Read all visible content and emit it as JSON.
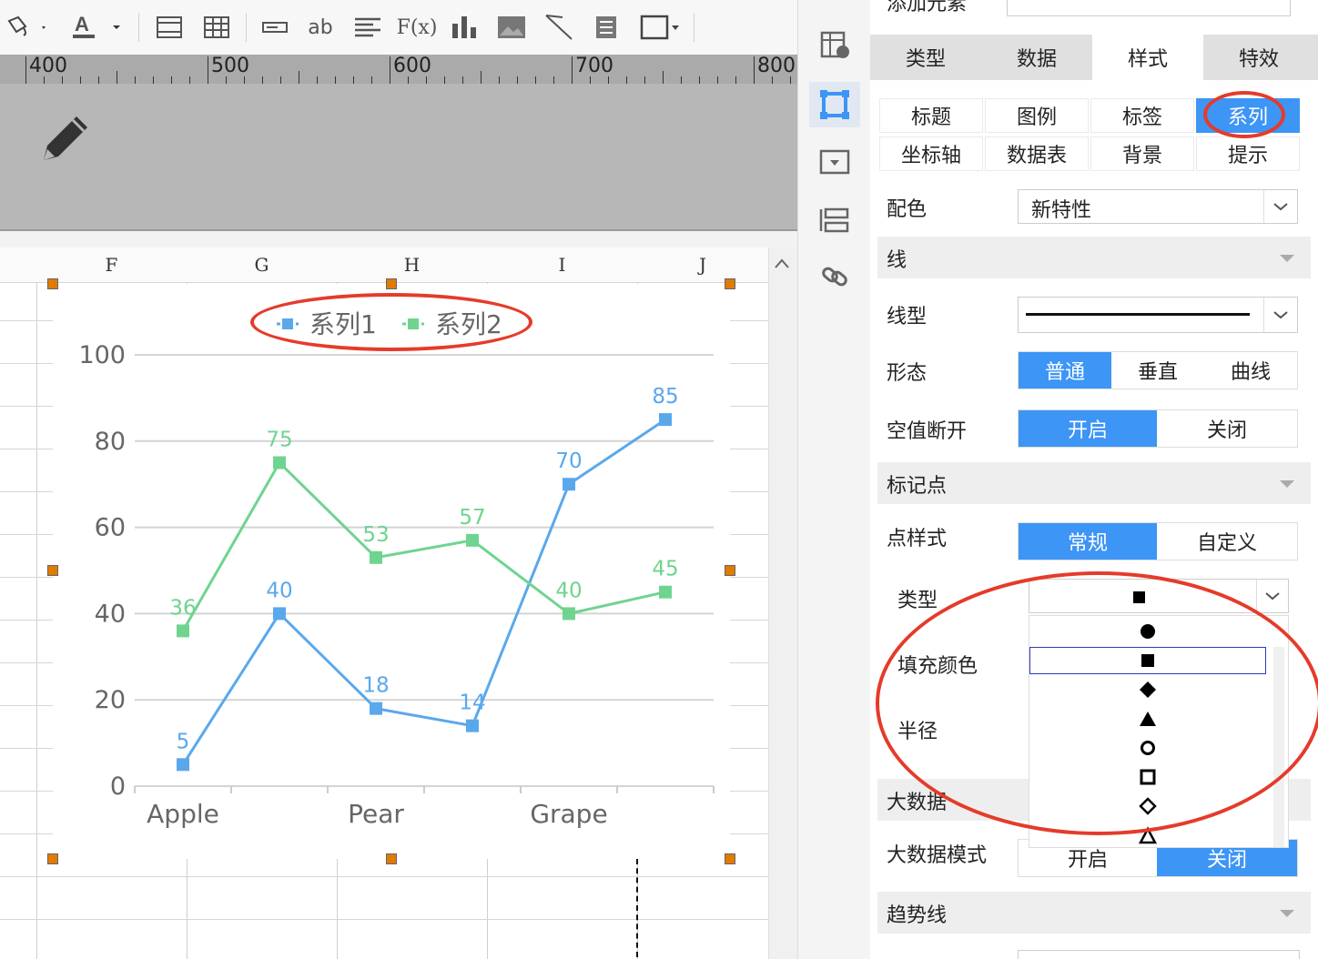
{
  "toolbar": {
    "text_button_label": "ab",
    "formula_button_label": "F(x)"
  },
  "ruler": {
    "labels": [
      "400",
      "500",
      "600",
      "700",
      "800"
    ]
  },
  "sheet": {
    "columns": [
      "F",
      "G",
      "H",
      "I",
      "J"
    ]
  },
  "chart_data": {
    "type": "line",
    "categories": [
      "Apple",
      "",
      "Pear",
      "",
      "Grape",
      ""
    ],
    "x_tick_labels": [
      "Apple",
      "Pear",
      "Grape"
    ],
    "series": [
      {
        "name": "系列1",
        "values": [
          5,
          40,
          18,
          14,
          70,
          85
        ],
        "color": "#5aa8ec"
      },
      {
        "name": "系列2",
        "values": [
          36,
          75,
          53,
          57,
          40,
          45
        ],
        "color": "#6fd48f"
      }
    ],
    "ylim": [
      0,
      100
    ],
    "yticks": [
      "0",
      "20",
      "40",
      "60",
      "80",
      "100"
    ],
    "legend_position": "top",
    "grid": true
  },
  "panel": {
    "top_label": "添加元素",
    "tabs": [
      "类型",
      "数据",
      "样式",
      "特效"
    ],
    "subtabs_row1": [
      "标题",
      "图例",
      "标签",
      "系列"
    ],
    "subtabs_row2": [
      "坐标轴",
      "数据表",
      "背景",
      "提示"
    ],
    "color_label": "配色",
    "color_value": "新特性",
    "line_section": "线",
    "line_type_label": "线型",
    "shape_label": "形态",
    "shape_options": [
      "普通",
      "垂直",
      "曲线"
    ],
    "null_break_label": "空值断开",
    "on_label": "开启",
    "off_label": "关闭",
    "marker_section": "标记点",
    "point_style_label": "点样式",
    "point_style_options": [
      "常规",
      "自定义"
    ],
    "type_label": "类型",
    "fill_color_label": "填充颜色",
    "radius_label": "半径",
    "bigdata_section": "大数据",
    "bigdata_mode_label": "大数据模式",
    "bigdata_on": "开启",
    "bigdata_off": "关闭",
    "trend_section": "趋势线"
  },
  "marker_dropdown": {
    "selected_icon": "filled-square",
    "options": [
      "filled-circle",
      "filled-square",
      "filled-diamond",
      "filled-triangle",
      "hollow-circle",
      "hollow-square",
      "hollow-diamond",
      "hollow-triangle"
    ]
  },
  "colors": {
    "accent": "#3d95f5",
    "series1": "#5aa8ec",
    "series2": "#6fd48f",
    "annotation": "#e53b2a"
  }
}
